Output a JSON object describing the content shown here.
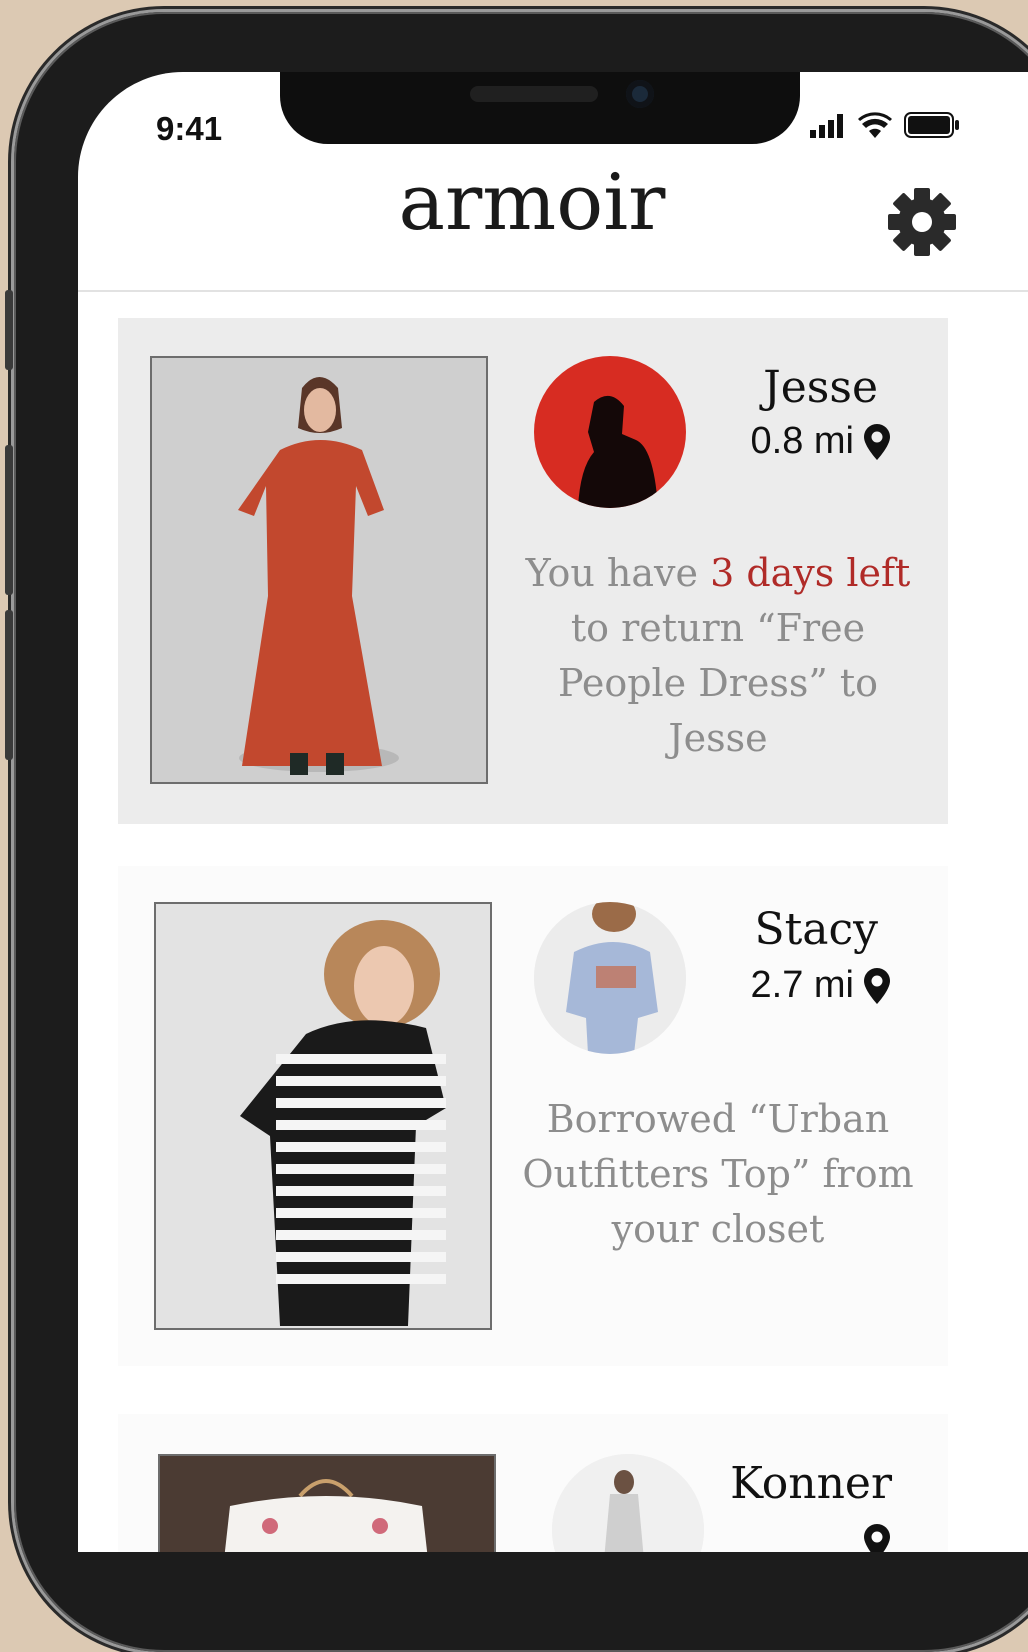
{
  "status_bar": {
    "time": "9:41"
  },
  "header": {
    "title": "armoir"
  },
  "colors": {
    "accent": "#b02b28",
    "card_active": "#ececec",
    "background": "#dcc9b3"
  },
  "cards": [
    {
      "name": "Jesse",
      "distance": "0.8 mi",
      "message": {
        "p1": "You have ",
        "highlight": "3 days left",
        "p2": " to return “Free People Dress” to Jesse"
      }
    },
    {
      "name": "Stacy",
      "distance": "2.7 mi",
      "message": {
        "text": "Borrowed “Urban Outfitters Top” from your closet"
      }
    },
    {
      "name": "Konner"
    }
  ]
}
